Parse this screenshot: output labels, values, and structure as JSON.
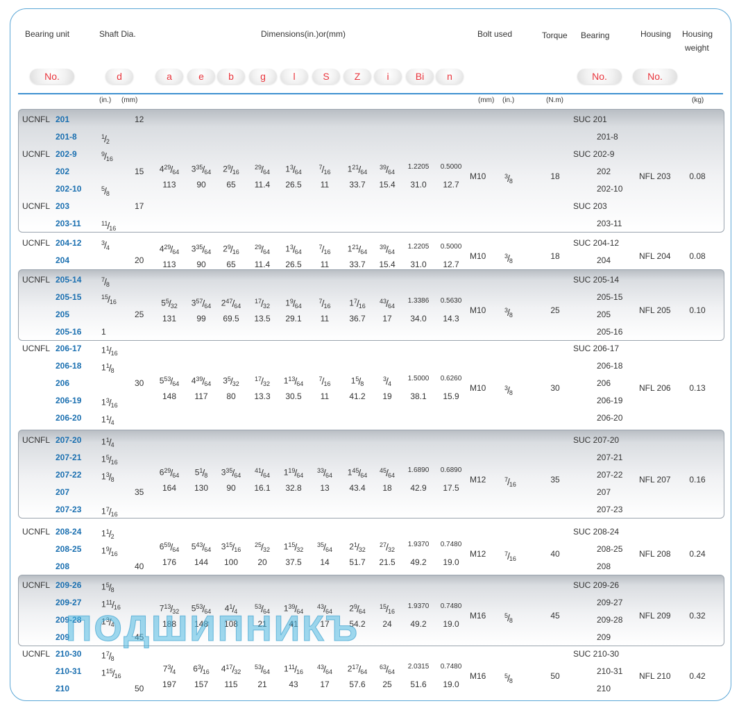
{
  "headers": {
    "bearing_unit": "Bearing unit",
    "shaft_dia": "Shaft Dia.",
    "dimensions": "Dimensions(in.)or(mm)",
    "bolt_used": "Bolt  used",
    "torque": "Torque",
    "bearing": "Bearing",
    "housing": "Housing",
    "housing_weight_1": "Housing",
    "housing_weight_2": "weight"
  },
  "symbols": {
    "no_left": "No.",
    "d": "d",
    "a": "a",
    "e": "e",
    "b": "b",
    "g": "g",
    "l": "l",
    "s": "S",
    "z": "Z",
    "i": "i",
    "bi": "Bi",
    "n": "n",
    "no_bearing": "No.",
    "no_housing": "No."
  },
  "units": {
    "inch": "(in.)",
    "mm": "(mm)",
    "bolt_mm": "(mm)",
    "bolt_inch": "(in.)",
    "torque": "(N.m)",
    "weight": "(kg)"
  },
  "watermark": "ПОДШИПНИКЪ",
  "groups": [
    {
      "band": true,
      "units": [
        {
          "prefix": "UCNFL",
          "num": "201",
          "d_in": "",
          "d_mm": "12",
          "bearing": "SUC 201"
        },
        {
          "prefix": "",
          "num": "201-8",
          "d_in": "1/2",
          "d_mm": "",
          "bearing": "201-8"
        },
        {
          "prefix": "UCNFL",
          "num": "202-9",
          "d_in": "9/16",
          "d_mm": "",
          "bearing": "SUC 202-9"
        },
        {
          "prefix": "",
          "num": "202",
          "d_in": "",
          "d_mm": "15",
          "bearing": "202"
        },
        {
          "prefix": "",
          "num": "202-10",
          "d_in": "5/8",
          "d_mm": "",
          "bearing": "202-10"
        },
        {
          "prefix": "UCNFL",
          "num": "203",
          "d_in": "",
          "d_mm": "17",
          "bearing": "SUC 203"
        },
        {
          "prefix": "",
          "num": "203-11",
          "d_in": "11/16",
          "d_mm": "",
          "bearing": "203-11"
        }
      ],
      "dims_in": [
        "4 29/64",
        "3 35/64",
        "2 9/16",
        "29/64",
        "1 3/64",
        "7/16",
        "1 21/64",
        "39/64",
        "1.2205",
        "0.5000"
      ],
      "dims_mm": [
        "113",
        "90",
        "65",
        "11.4",
        "26.5",
        "11",
        "33.7",
        "15.4",
        "31.0",
        "12.7"
      ],
      "bolt_mm": "M10",
      "bolt_in": "3/8",
      "torque": "18",
      "housing": "NFL 203",
      "weight": "0.08"
    },
    {
      "band": false,
      "units": [
        {
          "prefix": "UCNFL",
          "num": "204-12",
          "d_in": "3/4",
          "d_mm": "",
          "bearing": "SUC 204-12"
        },
        {
          "prefix": "",
          "num": "204",
          "d_in": "",
          "d_mm": "20",
          "bearing": "204"
        }
      ],
      "dims_in": [
        "4 29/64",
        "3 35/64",
        "2 9/16",
        "29/64",
        "1 3/64",
        "7/16",
        "1 21/64",
        "39/64",
        "1.2205",
        "0.5000"
      ],
      "dims_mm": [
        "113",
        "90",
        "65",
        "11.4",
        "26.5",
        "11",
        "33.7",
        "15.4",
        "31.0",
        "12.7"
      ],
      "bolt_mm": "M10",
      "bolt_in": "3/8",
      "torque": "18",
      "housing": "NFL 204",
      "weight": "0.08"
    },
    {
      "band": true,
      "units": [
        {
          "prefix": "UCNFL",
          "num": "205-14",
          "d_in": "7/8",
          "d_mm": "",
          "bearing": "SUC 205-14"
        },
        {
          "prefix": "",
          "num": "205-15",
          "d_in": "15/16",
          "d_mm": "",
          "bearing": "205-15"
        },
        {
          "prefix": "",
          "num": "205",
          "d_in": "",
          "d_mm": "25",
          "bearing": "205"
        },
        {
          "prefix": "",
          "num": "205-16",
          "d_in": "1",
          "d_mm": "",
          "bearing": "205-16"
        }
      ],
      "dims_in": [
        "5 5/32",
        "3 57/64",
        "2 47/64",
        "17/32",
        "1 9/64",
        "7/16",
        "1 7/16",
        "43/64",
        "1.3386",
        "0.5630"
      ],
      "dims_mm": [
        "131",
        "99",
        "69.5",
        "13.5",
        "29.1",
        "11",
        "36.7",
        "17",
        "34.0",
        "14.3"
      ],
      "bolt_mm": "M10",
      "bolt_in": "3/8",
      "torque": "25",
      "housing": "NFL 205",
      "weight": "0.10"
    },
    {
      "band": false,
      "units": [
        {
          "prefix": "UCNFL",
          "num": "206-17",
          "d_in": "1 1/16",
          "d_mm": "",
          "bearing": "SUC 206-17"
        },
        {
          "prefix": "",
          "num": "206-18",
          "d_in": "1 1/8",
          "d_mm": "",
          "bearing": "206-18"
        },
        {
          "prefix": "",
          "num": "206",
          "d_in": "",
          "d_mm": "30",
          "bearing": "206"
        },
        {
          "prefix": "",
          "num": "206-19",
          "d_in": "1 3/16",
          "d_mm": "",
          "bearing": "206-19"
        },
        {
          "prefix": "",
          "num": "206-20",
          "d_in": "1 1/4",
          "d_mm": "",
          "bearing": "206-20"
        }
      ],
      "dims_in": [
        "5 53/64",
        "4 39/64",
        "3 5/32",
        "17/32",
        "1 13/64",
        "7/16",
        "1 5/8",
        "3/4",
        "1.5000",
        "0.6260"
      ],
      "dims_mm": [
        "148",
        "117",
        "80",
        "13.3",
        "30.5",
        "11",
        "41.2",
        "19",
        "38.1",
        "15.9"
      ],
      "bolt_mm": "M10",
      "bolt_in": "3/8",
      "torque": "30",
      "housing": "NFL 206",
      "weight": "0.13"
    },
    {
      "band": true,
      "units": [
        {
          "prefix": "UCNFL",
          "num": "207-20",
          "d_in": "1 1/4",
          "d_mm": "",
          "bearing": "SUC 207-20"
        },
        {
          "prefix": "",
          "num": "207-21",
          "d_in": "1 5/16",
          "d_mm": "",
          "bearing": "207-21"
        },
        {
          "prefix": "",
          "num": "207-22",
          "d_in": "1 3/8",
          "d_mm": "",
          "bearing": "207-22"
        },
        {
          "prefix": "",
          "num": "207",
          "d_in": "",
          "d_mm": "35",
          "bearing": "207"
        },
        {
          "prefix": "",
          "num": "207-23",
          "d_in": "1 7/16",
          "d_mm": "",
          "bearing": "207-23"
        }
      ],
      "dims_in": [
        "6 29/64",
        "5 1/8",
        "3 35/64",
        "41/64",
        "1 19/64",
        "33/64",
        "1 45/64",
        "45/64",
        "1.6890",
        "0.6890"
      ],
      "dims_mm": [
        "164",
        "130",
        "90",
        "16.1",
        "32.8",
        "13",
        "43.4",
        "18",
        "42.9",
        "17.5"
      ],
      "bolt_mm": "M12",
      "bolt_in": "7/16",
      "torque": "35",
      "housing": "NFL 207",
      "weight": "0.16"
    },
    {
      "band": false,
      "units": [
        {
          "prefix": "UCNFL",
          "num": "208-24",
          "d_in": "1 1/2",
          "d_mm": "",
          "bearing": "SUC 208-24"
        },
        {
          "prefix": "",
          "num": "208-25",
          "d_in": "1 9/16",
          "d_mm": "",
          "bearing": "208-25"
        },
        {
          "prefix": "",
          "num": "208",
          "d_in": "",
          "d_mm": "40",
          "bearing": "208"
        }
      ],
      "dims_in": [
        "6 59/64",
        "5 43/64",
        "3 15/16",
        "25/32",
        "1 15/32",
        "35/64",
        "2 1/32",
        "27/32",
        "1.9370",
        "0.7480"
      ],
      "dims_mm": [
        "176",
        "144",
        "100",
        "20",
        "37.5",
        "14",
        "51.7",
        "21.5",
        "49.2",
        "19.0"
      ],
      "bolt_mm": "M12",
      "bolt_in": "7/16",
      "torque": "40",
      "housing": "NFL 208",
      "weight": "0.24"
    },
    {
      "band": true,
      "units": [
        {
          "prefix": "UCNFL",
          "num": "209-26",
          "d_in": "1 5/8",
          "d_mm": "",
          "bearing": "SUC 209-26"
        },
        {
          "prefix": "",
          "num": "209-27",
          "d_in": "1 11/16",
          "d_mm": "",
          "bearing": "209-27"
        },
        {
          "prefix": "",
          "num": "209-28",
          "d_in": "1 3/4",
          "d_mm": "",
          "bearing": "209-28"
        },
        {
          "prefix": "",
          "num": "209",
          "d_in": "",
          "d_mm": "45",
          "bearing": "209"
        }
      ],
      "dims_in": [
        "7 13/32",
        "5 53/64",
        "4 1/4",
        "53/64",
        "1 39/64",
        "43/64",
        "2 9/64",
        "15/16",
        "1.9370",
        "0.7480"
      ],
      "dims_mm": [
        "188",
        "148",
        "108",
        "21",
        "41",
        "17",
        "54.2",
        "24",
        "49.2",
        "19.0"
      ],
      "bolt_mm": "M16",
      "bolt_in": "5/8",
      "torque": "45",
      "housing": "NFL 209",
      "weight": "0.32"
    },
    {
      "band": false,
      "units": [
        {
          "prefix": "UCNFL",
          "num": "210-30",
          "d_in": "1 7/8",
          "d_mm": "",
          "bearing": "SUC 210-30"
        },
        {
          "prefix": "",
          "num": "210-31",
          "d_in": "1 15/16",
          "d_mm": "",
          "bearing": "210-31"
        },
        {
          "prefix": "",
          "num": "210",
          "d_in": "",
          "d_mm": "50",
          "bearing": "210"
        }
      ],
      "dims_in": [
        "7 3/4",
        "6 3/16",
        "4 17/32",
        "53/64",
        "1 11/16",
        "43/64",
        "2 17/64",
        "63/64",
        "2.0315",
        "0.7480"
      ],
      "dims_mm": [
        "197",
        "157",
        "115",
        "21",
        "43",
        "17",
        "57.6",
        "25",
        "51.6",
        "19.0"
      ],
      "bolt_mm": "M16",
      "bolt_in": "5/8",
      "torque": "50",
      "housing": "NFL 210",
      "weight": "0.42"
    }
  ]
}
